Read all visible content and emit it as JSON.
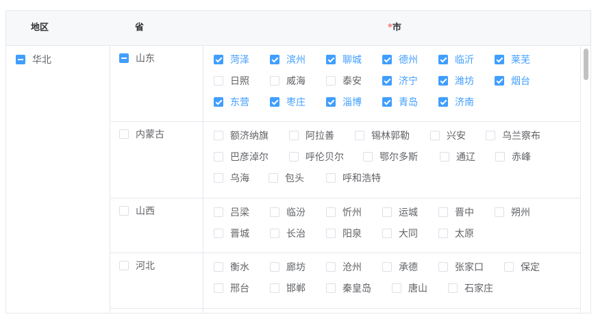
{
  "header": {
    "region": "地区",
    "province": "省",
    "city_required_mark": "*",
    "city": "市"
  },
  "regions": [
    {
      "label": "华北",
      "state": "indeterminate"
    }
  ],
  "provinces": [
    {
      "label": "山东",
      "state": "indeterminate",
      "cities": [
        {
          "label": "菏泽",
          "checked": true
        },
        {
          "label": "滨州",
          "checked": true
        },
        {
          "label": "聊城",
          "checked": true
        },
        {
          "label": "德州",
          "checked": true
        },
        {
          "label": "临沂",
          "checked": true
        },
        {
          "label": "莱芜",
          "checked": true
        },
        {
          "label": "日照",
          "checked": false
        },
        {
          "label": "威海",
          "checked": false
        },
        {
          "label": "泰安",
          "checked": false
        },
        {
          "label": "济宁",
          "checked": true
        },
        {
          "label": "潍坊",
          "checked": true
        },
        {
          "label": "烟台",
          "checked": true
        },
        {
          "label": "东营",
          "checked": true
        },
        {
          "label": "枣庄",
          "checked": true
        },
        {
          "label": "淄博",
          "checked": true
        },
        {
          "label": "青岛",
          "checked": true
        },
        {
          "label": "济南",
          "checked": true
        }
      ]
    },
    {
      "label": "内蒙古",
      "state": "unchecked",
      "cities": [
        {
          "label": "额济纳旗",
          "checked": false
        },
        {
          "label": "阿拉善",
          "checked": false
        },
        {
          "label": "锡林郭勒",
          "checked": false
        },
        {
          "label": "兴安",
          "checked": false
        },
        {
          "label": "乌兰察布",
          "checked": false
        },
        {
          "label": "巴彦淖尔",
          "checked": false
        },
        {
          "label": "呼伦贝尔",
          "checked": false
        },
        {
          "label": "鄂尔多斯",
          "checked": false
        },
        {
          "label": "通辽",
          "checked": false
        },
        {
          "label": "赤峰",
          "checked": false
        },
        {
          "label": "乌海",
          "checked": false
        },
        {
          "label": "包头",
          "checked": false
        },
        {
          "label": "呼和浩特",
          "checked": false
        }
      ]
    },
    {
      "label": "山西",
      "state": "unchecked",
      "cities": [
        {
          "label": "吕梁",
          "checked": false
        },
        {
          "label": "临汾",
          "checked": false
        },
        {
          "label": "忻州",
          "checked": false
        },
        {
          "label": "运城",
          "checked": false
        },
        {
          "label": "晋中",
          "checked": false
        },
        {
          "label": "朔州",
          "checked": false
        },
        {
          "label": "晋城",
          "checked": false
        },
        {
          "label": "长治",
          "checked": false
        },
        {
          "label": "阳泉",
          "checked": false
        },
        {
          "label": "大同",
          "checked": false
        },
        {
          "label": "太原",
          "checked": false
        }
      ]
    },
    {
      "label": "河北",
      "state": "unchecked",
      "cities": [
        {
          "label": "衡水",
          "checked": false
        },
        {
          "label": "廊坊",
          "checked": false
        },
        {
          "label": "沧州",
          "checked": false
        },
        {
          "label": "承德",
          "checked": false
        },
        {
          "label": "张家口",
          "checked": false
        },
        {
          "label": "保定",
          "checked": false
        },
        {
          "label": "邢台",
          "checked": false
        },
        {
          "label": "邯郸",
          "checked": false
        },
        {
          "label": "秦皇岛",
          "checked": false
        },
        {
          "label": "唐山",
          "checked": false
        },
        {
          "label": "石家庄",
          "checked": false
        }
      ]
    }
  ]
}
